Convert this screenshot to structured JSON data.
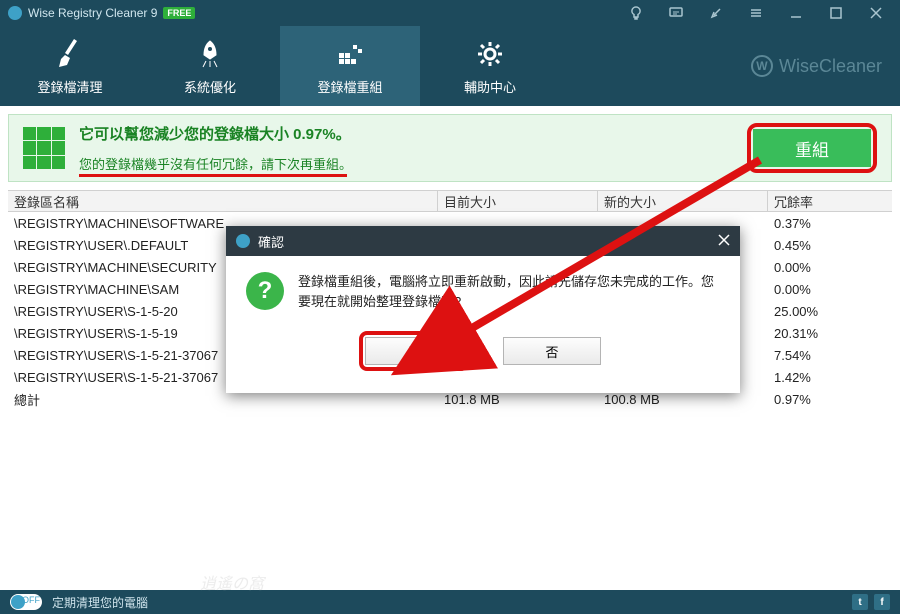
{
  "titlebar": {
    "app_name": "Wise Registry Cleaner 9",
    "badge": "FREE"
  },
  "tabs": {
    "clean": "登錄檔清理",
    "optimize": "系統優化",
    "defrag": "登錄檔重組",
    "help": "輔助中心"
  },
  "brand": "WiseCleaner",
  "banner": {
    "line1": "它可以幫您減少您的登錄檔大小 0.97%。",
    "line2": "您的登錄檔幾乎沒有任何冗餘，請下次再重組。",
    "button": "重組"
  },
  "table": {
    "headers": {
      "name": "登錄區名稱",
      "current": "目前大小",
      "new": "新的大小",
      "ratio": "冗餘率"
    },
    "rows": [
      {
        "name": "\\REGISTRY\\MACHINE\\SOFTWARE",
        "current": "",
        "new": "",
        "ratio": "0.37%"
      },
      {
        "name": "\\REGISTRY\\USER\\.DEFAULT",
        "current": "",
        "new": "",
        "ratio": "0.45%"
      },
      {
        "name": "\\REGISTRY\\MACHINE\\SECURITY",
        "current": "",
        "new": "",
        "ratio": "0.00%"
      },
      {
        "name": "\\REGISTRY\\MACHINE\\SAM",
        "current": "",
        "new": "",
        "ratio": "0.00%"
      },
      {
        "name": "\\REGISTRY\\USER\\S-1-5-20",
        "current": "",
        "new": "",
        "ratio": "25.00%"
      },
      {
        "name": "\\REGISTRY\\USER\\S-1-5-19",
        "current": "",
        "new": "",
        "ratio": "20.31%"
      },
      {
        "name": "\\REGISTRY\\USER\\S-1-5-21-37067",
        "current": "",
        "new": "",
        "ratio": "7.54%"
      },
      {
        "name": "\\REGISTRY\\USER\\S-1-5-21-37067",
        "current": "",
        "new": "",
        "ratio": "1.42%"
      },
      {
        "name": "總計",
        "current": "101.8 MB",
        "new": "100.8 MB",
        "ratio": "0.97%"
      }
    ]
  },
  "dialog": {
    "title": "確認",
    "message": "登錄檔重組後，電腦將立即重新啟動，因此請先儲存您未完成的工作。您要現在就開始整理登錄檔嗎?",
    "yes": "是",
    "no": "否"
  },
  "statusbar": {
    "toggle": "OFF",
    "text": "定期清理您的電腦"
  }
}
